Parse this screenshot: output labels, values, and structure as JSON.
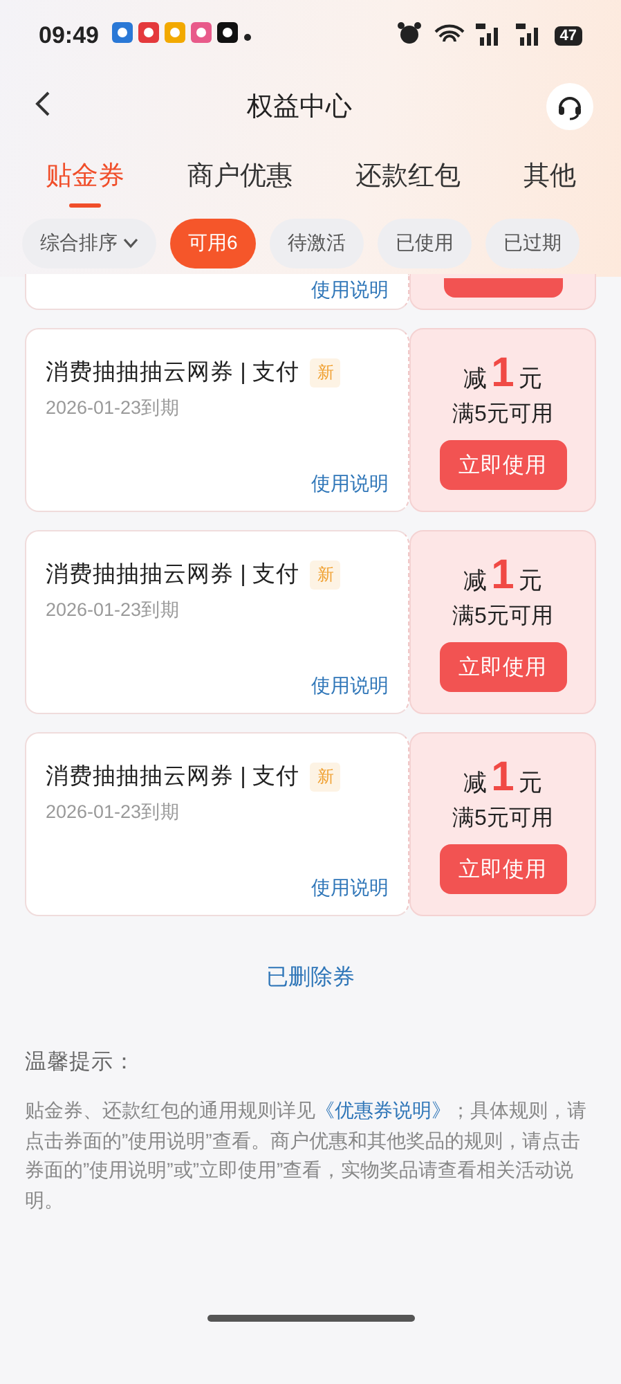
{
  "status_bar": {
    "time": "09:49",
    "battery": "47"
  },
  "header": {
    "title": "权益中心"
  },
  "tabs": [
    {
      "label": "贴金券",
      "selected": true
    },
    {
      "label": "商户优惠",
      "selected": false
    },
    {
      "label": "还款红包",
      "selected": false
    },
    {
      "label": "其他",
      "selected": false
    }
  ],
  "filters": [
    {
      "label": "综合排序",
      "kind": "dropdown",
      "selected": false
    },
    {
      "label": "可用6",
      "kind": "chip",
      "selected": true
    },
    {
      "label": "待激活",
      "kind": "chip",
      "selected": false
    },
    {
      "label": "已使用",
      "kind": "chip",
      "selected": false
    },
    {
      "label": "已过期",
      "kind": "chip",
      "selected": false
    }
  ],
  "partial_coupon": {
    "link": "使用说明"
  },
  "coupons": [
    {
      "title": "消费抽抽抽云网券 | 支付",
      "tag": "新",
      "expiry": "2026-01-23到期",
      "link": "使用说明",
      "prefix": "减",
      "amount": "1",
      "unit": "元",
      "condition": "满5元可用",
      "button": "立即使用"
    },
    {
      "title": "消费抽抽抽云网券 | 支付",
      "tag": "新",
      "expiry": "2026-01-23到期",
      "link": "使用说明",
      "prefix": "减",
      "amount": "1",
      "unit": "元",
      "condition": "满5元可用",
      "button": "立即使用"
    },
    {
      "title": "消费抽抽抽云网券 | 支付",
      "tag": "新",
      "expiry": "2026-01-23到期",
      "link": "使用说明",
      "prefix": "减",
      "amount": "1",
      "unit": "元",
      "condition": "满5元可用",
      "button": "立即使用"
    }
  ],
  "deleted_link": "已删除券",
  "tips": {
    "title": "温馨提示：",
    "text_before": "贴金券、还款红包的通用规则详见",
    "link": "《优惠券说明》",
    "text_after": "；具体规则，请点击券面的”使用说明”查看。商户优惠和其他奖品的规则，请点击券面的”使用说明”或”立即使用”查看，实物奖品请查看相关活动说明。"
  }
}
